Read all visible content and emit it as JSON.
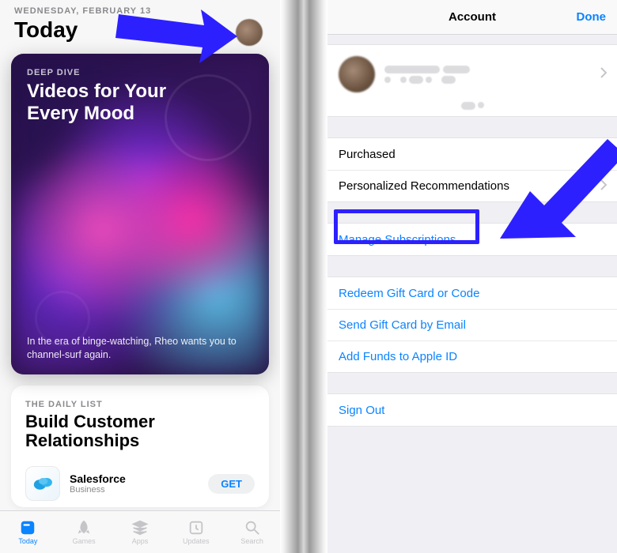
{
  "left": {
    "date": "WEDNESDAY, FEBRUARY 13",
    "title": "Today",
    "dd_eyebrow": "DEEP DIVE",
    "dd_title": "Videos for Your Every Mood",
    "dd_caption": "In the era of binge-watching, Rheo wants you to channel-surf again.",
    "list_eyebrow": "THE DAILY LIST",
    "list_title": "Build Customer Relationships",
    "app_name": "Salesforce",
    "app_category": "Business",
    "get_label": "GET"
  },
  "tabs": {
    "today": "Today",
    "games": "Games",
    "apps": "Apps",
    "updates": "Updates",
    "search": "Search"
  },
  "right": {
    "nav_title": "Account",
    "done": "Done",
    "purchased": "Purchased",
    "recommend": "Personalized Recommendations",
    "manage_subs": "Manage Subscriptions",
    "redeem": "Redeem Gift Card or Code",
    "send_gift": "Send Gift Card by Email",
    "add_funds": "Add Funds to Apple ID",
    "sign_out": "Sign Out"
  }
}
